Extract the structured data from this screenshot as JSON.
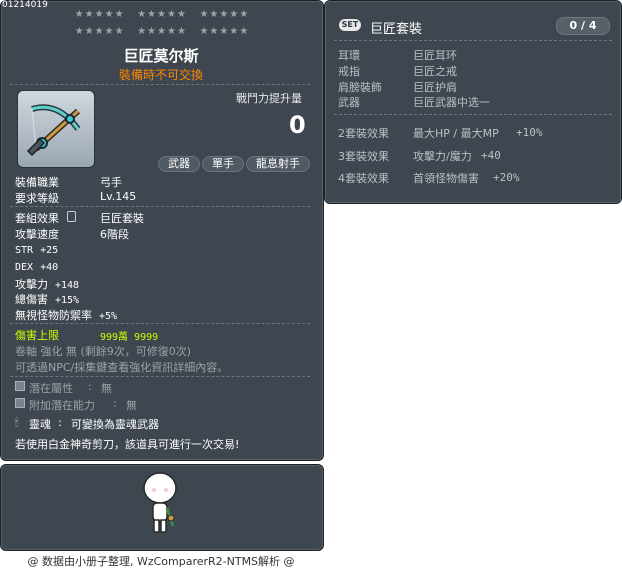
{
  "item": {
    "id": "01214019",
    "stars": [
      "★★★★★",
      "★★★★★",
      "★★★★★",
      "★★★★★",
      "★★★★★",
      "★★★★★"
    ],
    "name": "巨匠莫尔斯",
    "tradeable_note": "裝備時不可交換",
    "damage_increase_label": "戰鬥力提升量",
    "damage_increase_value": "0",
    "tags": [
      "武器",
      "單手",
      "龍息射手"
    ],
    "job_label": "裝備職業",
    "job_value": "弓手",
    "level_label": "要求等級",
    "level_value": "Lv.145",
    "set_label": "套組效果",
    "set_value": "巨匠套裝",
    "speed_label": "攻擊速度",
    "speed_value": "6階段",
    "stats": [
      {
        "name": "STR",
        "value": "+25"
      },
      {
        "name": "DEX",
        "value": "+40"
      },
      {
        "name": "攻擊力",
        "value": "+148"
      },
      {
        "name": "總傷害",
        "value": "+15%"
      },
      {
        "name": "無視怪物防禦率",
        "value": "+5%"
      }
    ],
    "damage_cap_label": "傷害上限",
    "damage_cap_value": "999萬 9999",
    "scroll_text": "卷軸 強化 無 (剩餘9次，可修復0次)",
    "npc_text": "可透過NPC/採集鍵查看強化資訊詳細內容。",
    "potential_label": "潛在屬性",
    "potential_value": "無",
    "add_potential_label": "附加潛在能力",
    "add_potential_value": "無",
    "soul_label": "靈魂",
    "soul_value": "可變換為靈魂武器",
    "scissors_text": "若使用白金神奇剪刀，該道具可進行一次交易!"
  },
  "set_panel": {
    "badge": "SET",
    "name": "巨匠套裝",
    "count": "0 / 4",
    "parts": [
      {
        "slot": "耳環",
        "item": "巨匠耳环"
      },
      {
        "slot": "戒指",
        "item": "巨匠之戒"
      },
      {
        "slot": "肩膀裝飾",
        "item": "巨匠护肩"
      },
      {
        "slot": "武器",
        "item": "巨匠武器中选一"
      }
    ],
    "effects": [
      {
        "tier": "2套裝效果",
        "text": "最大HP / 最大MP",
        "value": "+10%"
      },
      {
        "tier": "3套裝效果",
        "text": "攻擊力/魔力",
        "value": "+40"
      },
      {
        "tier": "4套裝效果",
        "text": "首領怪物傷害",
        "value": "+20%"
      }
    ]
  },
  "footer": "@ 数据由小册子整理, WzComparerR2-NTMS解析 @",
  "colors": {
    "panel_bg": "#3e464f",
    "accent_orange": "#ff8800",
    "accent_yellow": "#ccff00"
  }
}
